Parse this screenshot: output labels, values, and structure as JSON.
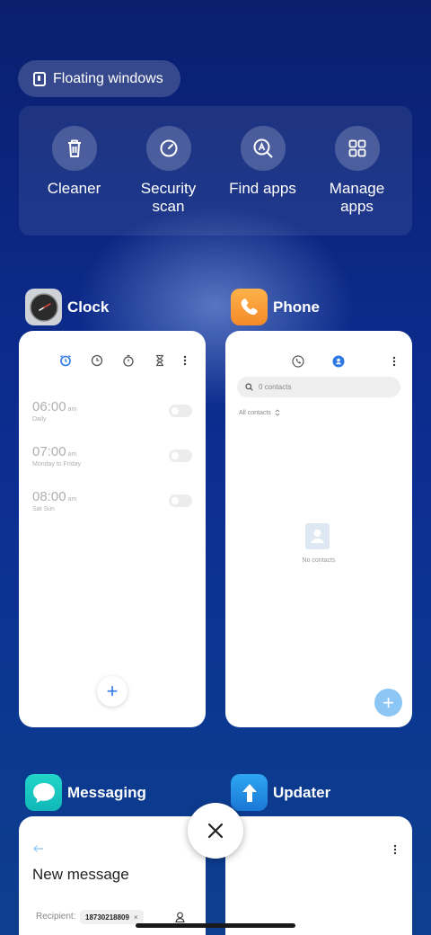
{
  "floating_windows": {
    "label": "Floating windows"
  },
  "tools": [
    {
      "label": "Cleaner",
      "icon": "trash-icon"
    },
    {
      "label": "Security\nscan",
      "icon": "security-scan-icon"
    },
    {
      "label": "Find apps",
      "icon": "find-apps-icon"
    },
    {
      "label": "Manage\napps",
      "icon": "grid-icon"
    }
  ],
  "clock": {
    "name": "Clock",
    "alarms": [
      {
        "time": "06:00",
        "ampm": "am",
        "repeat": "Daily"
      },
      {
        "time": "07:00",
        "ampm": "am",
        "repeat": "Monday to Friday"
      },
      {
        "time": "08:00",
        "ampm": "am",
        "repeat": "Sat Sun"
      }
    ]
  },
  "phone": {
    "name": "Phone",
    "search_placeholder": "0 contacts",
    "filter": "All contacts",
    "empty": "No contacts"
  },
  "messaging": {
    "name": "Messaging",
    "title": "New message",
    "recipient_label": "Recipient:",
    "recipient": "18730218809"
  },
  "updater": {
    "name": "Updater"
  },
  "colors": {
    "accent": "#2e78e6",
    "phone_fab": "#8cc6f5",
    "messaging_icon": "#16c7c0",
    "updater_icon": "#1e8ee8",
    "phone_icon": "#f5a03a"
  }
}
